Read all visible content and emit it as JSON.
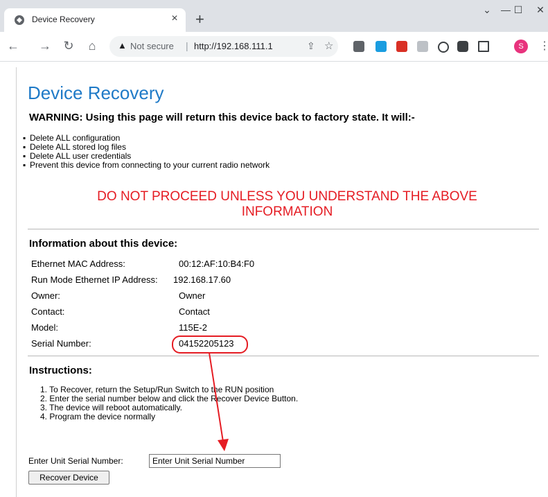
{
  "browser": {
    "tab_title": "Device Recovery",
    "tab_close": "×",
    "new_tab": "+",
    "window_controls": {
      "dropdown": "⌄",
      "minimize": "—",
      "maximize": "☐",
      "close": "✕"
    },
    "nav": {
      "back": "←",
      "forward": "→",
      "reload": "↻",
      "home": "⌂"
    },
    "omnibox": {
      "warning_icon": "▲",
      "security_label": "Not secure",
      "separator": "|",
      "url": "http://192.168.111.1"
    },
    "profile_initial": "S",
    "icons": [
      "back-icon",
      "forward-icon",
      "reload-icon",
      "home-icon",
      "share-icon",
      "star-icon",
      "extension-icon",
      "puzzle-icon",
      "sidepanel-icon",
      "kebab-menu-icon"
    ]
  },
  "page": {
    "title": "Device Recovery",
    "warning": "WARNING: Using this page will return this device back to factory state. It will:-",
    "bullets": [
      "Delete ALL configuration",
      "Delete ALL stored log files",
      "Delete ALL user credentials",
      "Prevent this device from connecting to your current radio network"
    ],
    "notice_line1": "DO NOT PROCEED UNLESS YOU UNDERSTAND THE ABOVE",
    "notice_line2": "INFORMATION",
    "info_title": "Information about this device:",
    "info": [
      {
        "label": "Ethernet MAC Address:",
        "value": "00:12:AF:10:B4:F0"
      },
      {
        "label": "Run Mode Ethernet IP Address:",
        "value": "192.168.17.60"
      },
      {
        "label": "Owner:",
        "value": "Owner"
      },
      {
        "label": "Contact:",
        "value": "Contact"
      },
      {
        "label": "Model:",
        "value": "115E-2"
      },
      {
        "label": "Serial Number:",
        "value": "04152205123"
      }
    ],
    "instructions_title": "Instructions:",
    "steps": [
      "1. To Recover, return the Setup/Run Switch to the RUN position",
      "2. Enter the serial number below and click the Recover Device Button.",
      "3. The device will reboot automatically.",
      "4. Program the device normally"
    ],
    "serial_label": "Enter Unit Serial Number:",
    "serial_placeholder": "Enter Unit Serial Number",
    "recover_button": "Recover Device"
  },
  "colors": {
    "heading": "#1f7ac7",
    "notice": "#e51c23",
    "annotation": "#e51c23"
  }
}
